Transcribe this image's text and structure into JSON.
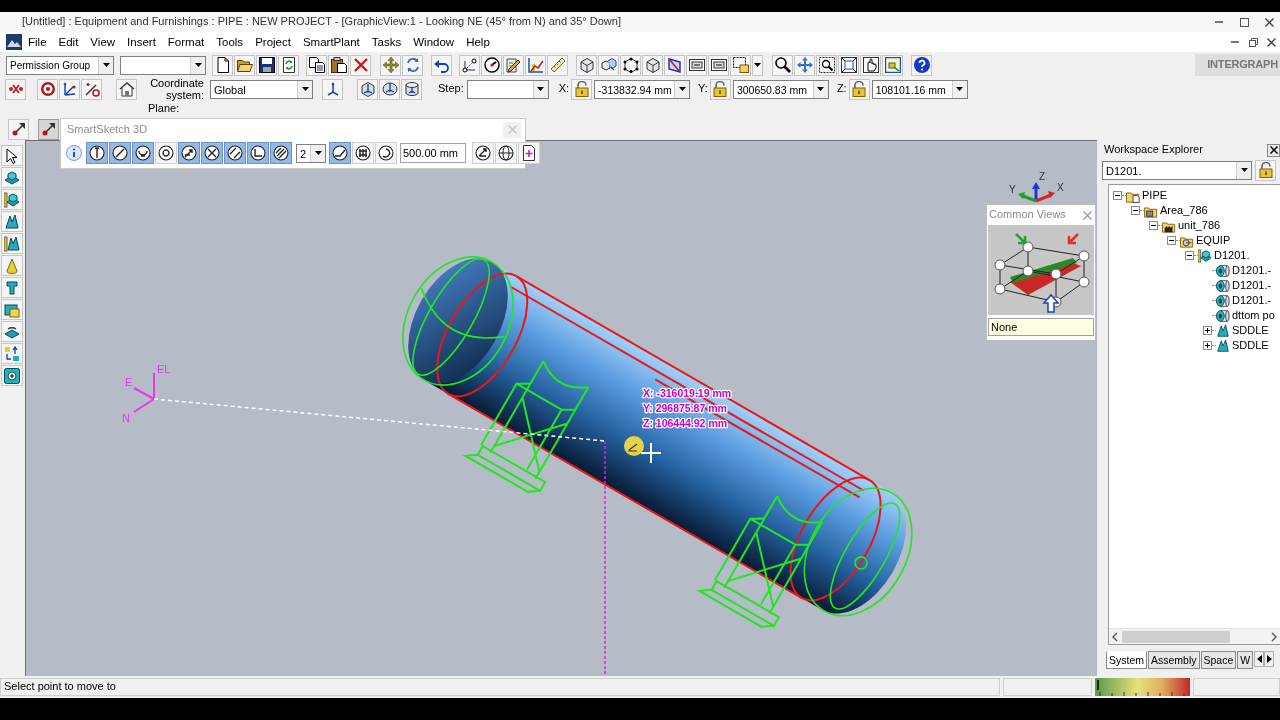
{
  "window": {
    "title": "[Untitled] : Equipment and Furnishings : PIPE : NEW PROJECT - [GraphicView:1 - Looking NE (45° from N) and 35° Down]"
  },
  "menu": [
    "File",
    "Edit",
    "View",
    "Insert",
    "Format",
    "Tools",
    "Project",
    "SmartPlant",
    "Tasks",
    "Window",
    "Help"
  ],
  "toolbar": {
    "permission_group": "Permission Group",
    "brand": "INTERGRAPH"
  },
  "coordinates": {
    "system_label": "Coordinate system:",
    "system": "Global",
    "step_label": "Step:",
    "plane_label": "Plane:",
    "fields": [
      {
        "label": "X:",
        "value": "-313832.94 mm"
      },
      {
        "label": "Y:",
        "value": "300650.83 mm"
      },
      {
        "label": "Z:",
        "value": "108101.16 mm"
      }
    ]
  },
  "smartsketch": {
    "title": "SmartSketch 3D",
    "toggles": [
      {
        "on": true
      },
      {
        "on": true
      },
      {
        "on": true
      },
      {
        "on": false
      },
      {
        "on": true
      },
      {
        "on": true
      },
      {
        "on": true
      },
      {
        "on": true
      },
      {
        "on": true
      },
      {
        "on": true
      },
      {
        "on": false
      },
      {
        "on": false
      }
    ],
    "count": "2",
    "distance": "500.00 mm"
  },
  "graphic_view": {
    "axis_labels": [
      "EL",
      "E",
      "N"
    ],
    "compass_labels": [
      "Z",
      "Y",
      "X"
    ],
    "readout": [
      "X: -316019.19 mm",
      "Y: 296875.87 mm",
      "Z: 106444.92 mm"
    ]
  },
  "common_views": {
    "title": "Common Views",
    "value": "None"
  },
  "workspace_explorer": {
    "title": "Workspace Explorer",
    "filter": "D1201.",
    "tree": [
      {
        "label": "PIPE",
        "kind": "system",
        "expanded": true,
        "children": [
          {
            "label": "Area_786",
            "kind": "area",
            "expanded": true,
            "children": [
              {
                "label": "unit_786",
                "kind": "unit",
                "expanded": true,
                "children": [
                  {
                    "label": "EQUIP",
                    "kind": "equipment-system",
                    "expanded": true,
                    "children": [
                      {
                        "label": "D1201.",
                        "kind": "equipment",
                        "expanded": true,
                        "children": [
                          {
                            "label": "D1201.-",
                            "kind": "nozzle"
                          },
                          {
                            "label": "D1201.-",
                            "kind": "nozzle"
                          },
                          {
                            "label": "D1201.-",
                            "kind": "nozzle"
                          },
                          {
                            "label": "dttom po",
                            "kind": "nozzle"
                          },
                          {
                            "label": "SDDLE",
                            "kind": "saddle",
                            "expanded": false
                          },
                          {
                            "label": "SDDLE",
                            "kind": "saddle",
                            "expanded": false
                          }
                        ]
                      }
                    ]
                  }
                ]
              }
            ]
          }
        ]
      }
    ],
    "tabs": [
      {
        "label": "System",
        "selected": true
      },
      {
        "label": "Assembly",
        "selected": false
      },
      {
        "label": "Space",
        "selected": false
      },
      {
        "label": "W",
        "selected": false
      }
    ]
  },
  "status_bar": {
    "prompt": "Select point to move to"
  }
}
